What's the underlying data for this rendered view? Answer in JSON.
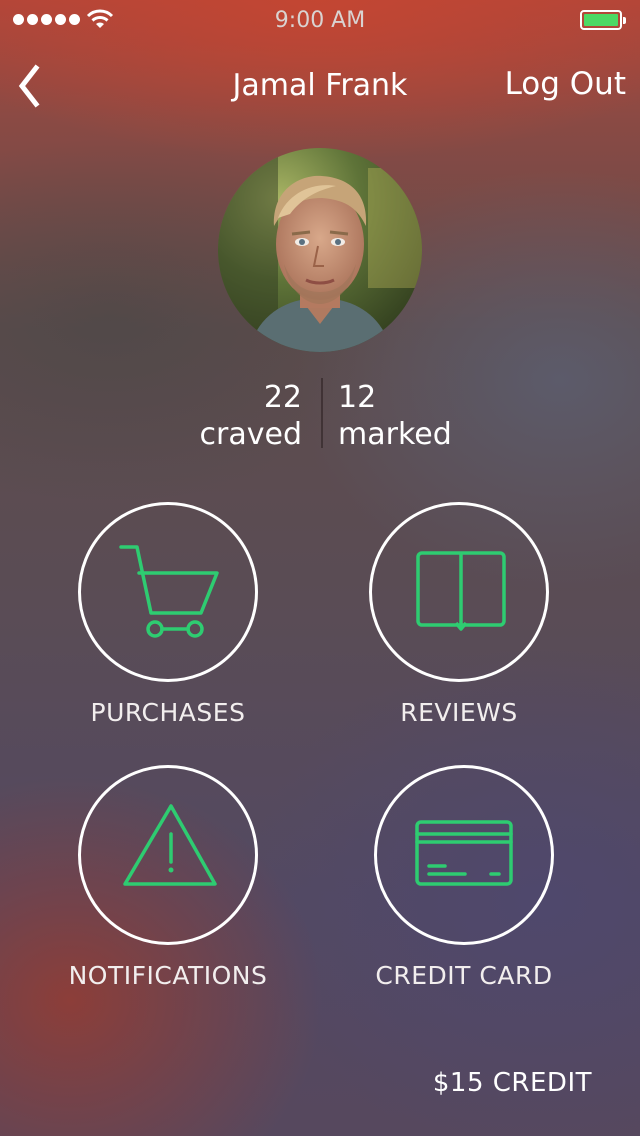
{
  "status_bar": {
    "time": "9:00 AM",
    "signal_icon": "signal-dots-icon",
    "wifi_icon": "wifi-icon",
    "battery_icon": "battery-icon",
    "battery_color": "#4cd964"
  },
  "header": {
    "back_icon": "chevron-left-icon",
    "title": "Jamal Frank",
    "logout_label": "Log Out"
  },
  "profile": {
    "avatar_icon": "profile-photo"
  },
  "stats": [
    {
      "value": "22",
      "label": "craved"
    },
    {
      "value": "12",
      "label": "marked"
    }
  ],
  "menu": {
    "items": [
      {
        "label": "PURCHASES",
        "icon": "shopping-cart-icon"
      },
      {
        "label": "REVIEWS",
        "icon": "book-icon"
      },
      {
        "label": "NOTIFICATIONS",
        "icon": "warning-icon"
      },
      {
        "label": "CREDIT CARD",
        "icon": "credit-card-icon"
      }
    ],
    "icon_color": "#2ecc71"
  },
  "footer": {
    "credit_label": "$15 CREDIT"
  }
}
